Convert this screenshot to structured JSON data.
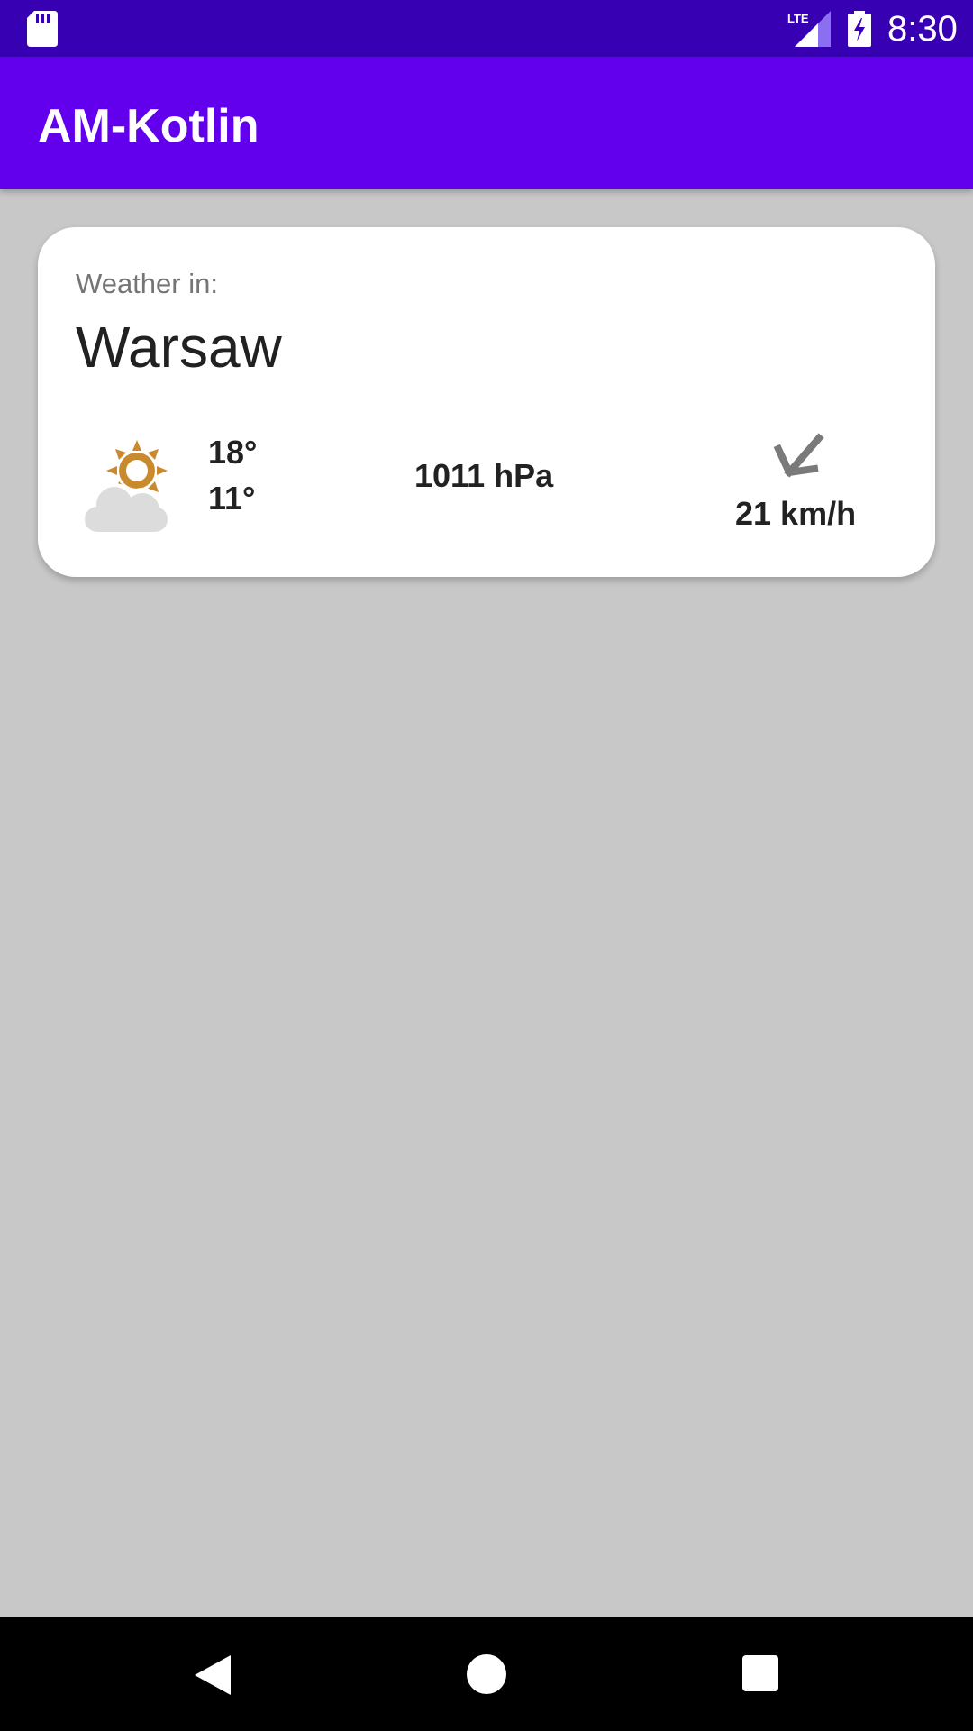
{
  "status_bar": {
    "time": "8:30",
    "network_label": "LTE",
    "icons": [
      "sd-card-icon",
      "lte-signal-icon",
      "battery-charging-icon"
    ]
  },
  "app_bar": {
    "title": "AM-Kotlin"
  },
  "weather": {
    "label": "Weather in:",
    "city": "Warsaw",
    "condition_icon": "partly-cloudy-icon",
    "temp_high": "18°",
    "temp_low": "11°",
    "pressure": "1011 hPa",
    "wind_icon": "wind-direction-arrow-icon",
    "wind_speed": "21 km/h"
  },
  "nav_bar": {
    "icons": [
      "back-icon",
      "home-icon",
      "recents-icon"
    ]
  },
  "colors": {
    "status_bar": "#3700b3",
    "app_bar": "#6200ee",
    "background": "#c8c8c8",
    "card": "#ffffff",
    "sun": "#c98a2e",
    "cloud": "#dcdcdc",
    "wind_arrow": "#7a7a7a"
  }
}
